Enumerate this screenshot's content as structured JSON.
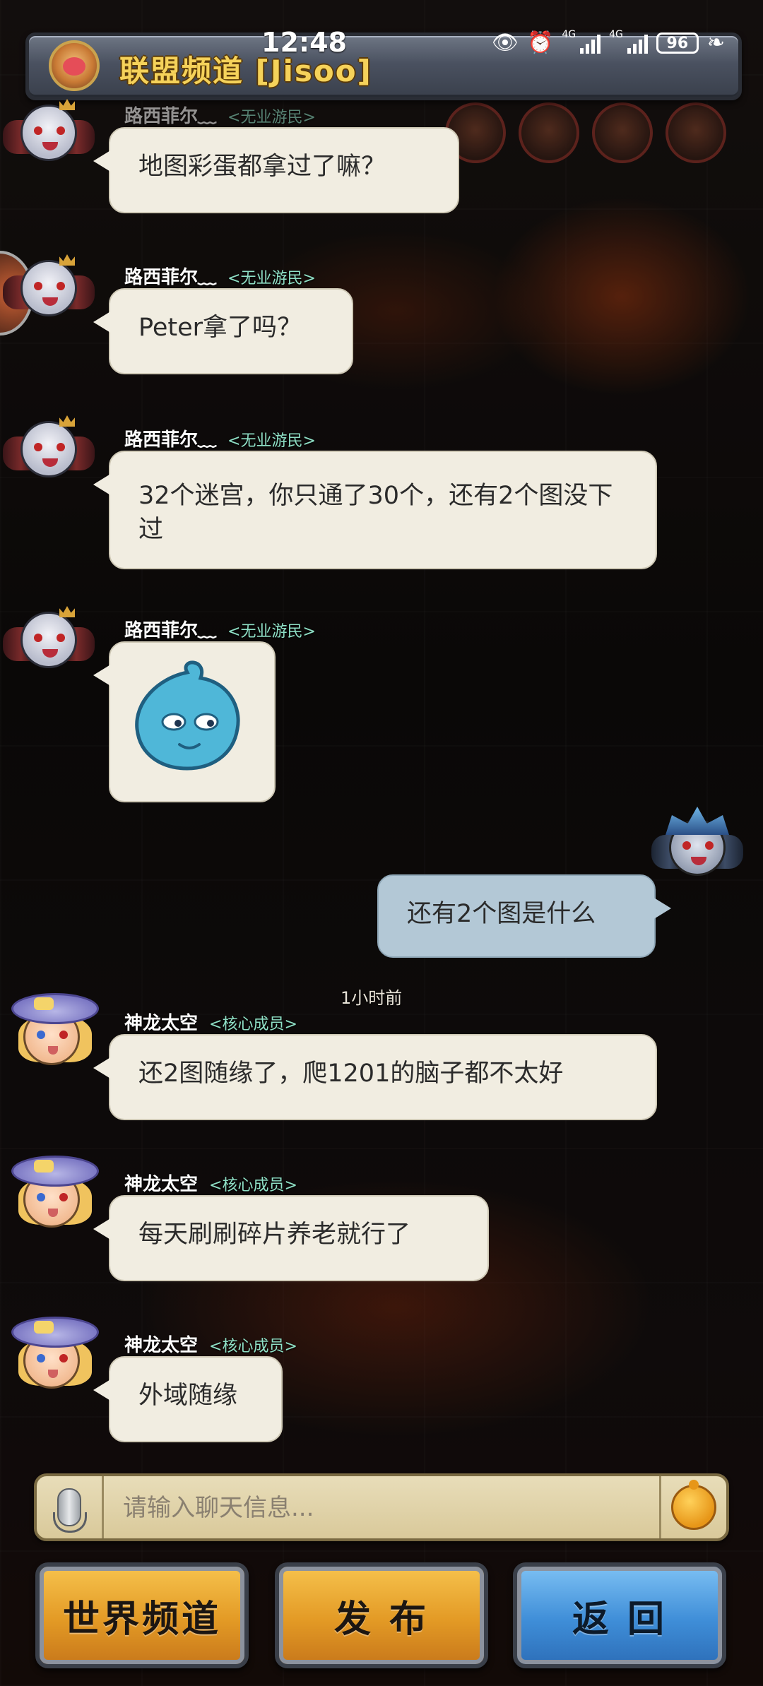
{
  "status_bar": {
    "time": "12:48",
    "network_1": "4G",
    "network_2": "4G",
    "battery": "96"
  },
  "header": {
    "title": "联盟频道 [Jisoo]"
  },
  "messages": [
    {
      "user": "路西菲尔﹏",
      "role": "<无业游民>",
      "text": "地图彩蛋都拿过了嘛？"
    },
    {
      "user": "路西菲尔﹏",
      "role": "<无业游民>",
      "text": "Peter拿了吗？"
    },
    {
      "user": "路西菲尔﹏",
      "role": "<无业游民>",
      "text": "32个迷宫，你只通了30个，还有2个图没下过"
    },
    {
      "user": "路西菲尔﹏",
      "role": "<无业游民>",
      "text": ""
    },
    {
      "user": "",
      "role": "",
      "text": "还有2个图是什么"
    },
    {
      "user": "神龙太空",
      "role": "<核心成员>",
      "text": "还2图随缘了，爬1201的脑子都不太好"
    },
    {
      "user": "神龙太空",
      "role": "<核心成员>",
      "text": "每天刷刷碎片养老就行了"
    },
    {
      "user": "神龙太空",
      "role": "<核心成员>",
      "text": "外域随缘"
    }
  ],
  "time_label": "1小时前",
  "input": {
    "placeholder": "请输入聊天信息..."
  },
  "buttons": {
    "world": "世界频道",
    "publish": "发 布",
    "back": "返 回"
  },
  "colors": {
    "bubble": "#f1ede1",
    "self_bubble": "#b3c8d6",
    "gold_button": "#e39a25",
    "blue_button": "#3f8ed8",
    "title": "#f5d25a"
  }
}
